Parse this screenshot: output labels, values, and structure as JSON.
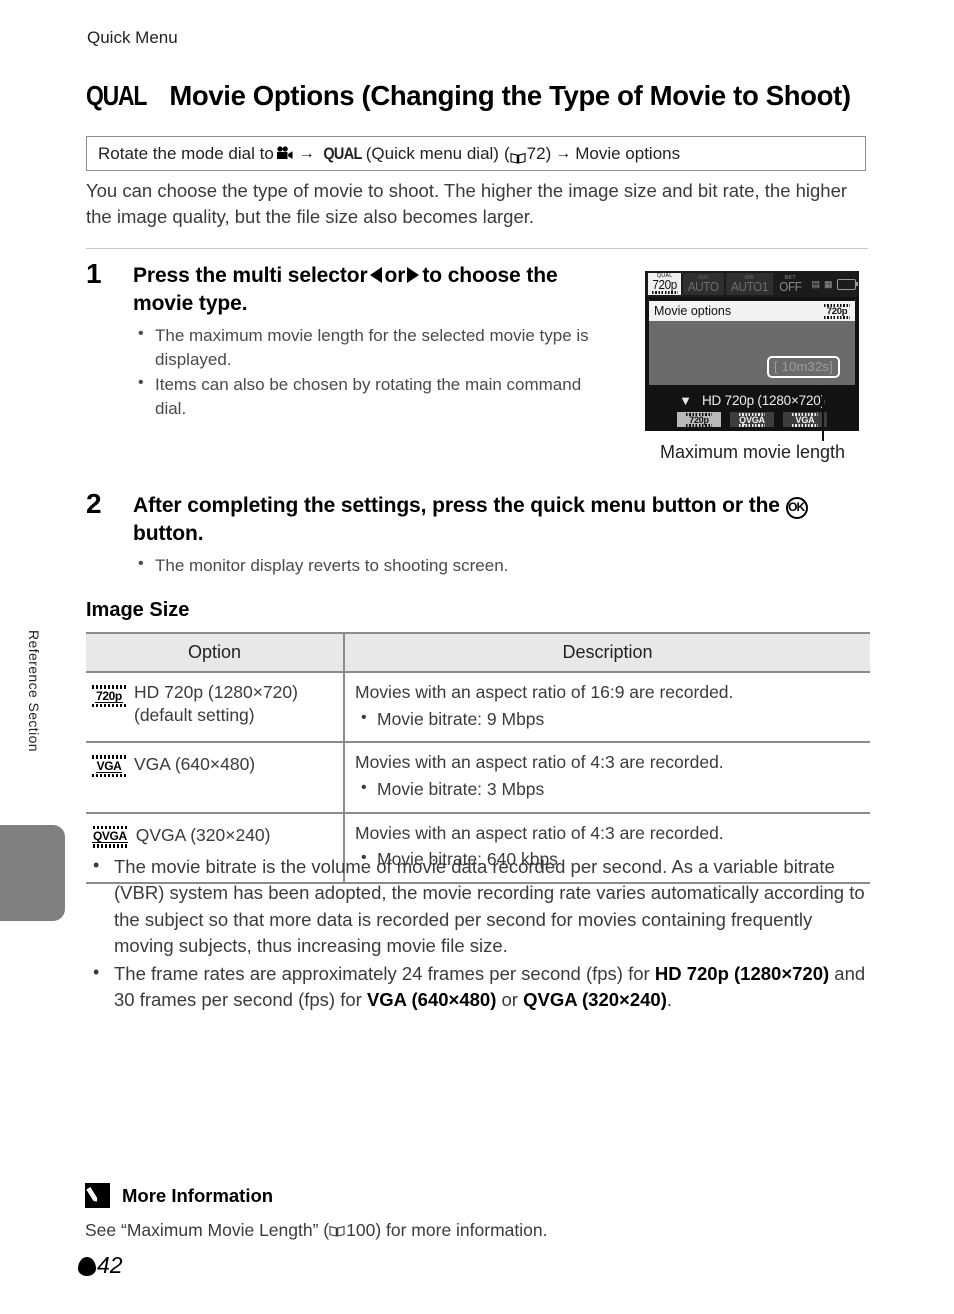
{
  "running_head": "Quick Menu",
  "side_tab_label": "Reference Section",
  "title": {
    "icon_label": "QUAL",
    "text": "Movie Options (Changing the Type of Movie to Shoot)"
  },
  "path_box": {
    "part1": "Rotate the mode dial to",
    "movie_icon": "movie-mode-icon",
    "arrow1": "→",
    "qual_icon": "QUAL",
    "part2": "(Quick menu dial)",
    "open_paren": "(",
    "book_ref": "72",
    "close_paren": ")",
    "arrow2": "→",
    "part3": "Movie options"
  },
  "intro": "You can choose the type of movie to shoot. The higher the image size and bit rate, the higher the image quality, but the file size also becomes larger.",
  "steps": [
    {
      "number": "1",
      "head_before": "Press the multi selector",
      "head_or": "or",
      "head_after": "to choose the movie type.",
      "bullets": [
        "The maximum movie length for the selected movie type is displayed.",
        "Items can also be chosen by rotating the main command dial."
      ]
    },
    {
      "number": "2",
      "head_before": "After completing the settings, press the quick menu button or the",
      "ok_glyph": "OK",
      "head_after": "button.",
      "bullets": [
        "The monitor display reverts to shooting screen."
      ]
    }
  ],
  "camera_screen": {
    "topbar": [
      {
        "sup": "QUAL",
        "main": "720p",
        "state": "active"
      },
      {
        "sup": "ISO",
        "main": "AUTO",
        "state": "dim"
      },
      {
        "sup": "WB",
        "main": "AUTO1",
        "state": "dim"
      },
      {
        "sup": "BKT",
        "main": "OFF",
        "state": "plain"
      }
    ],
    "topbar_icons": [
      "mg-icon",
      "sd-card-icon",
      "battery-icon"
    ],
    "menu_row_label": "Movie options",
    "menu_row_badge": "720p",
    "max_length_value": "[ 10m32s]",
    "bottom_label": "HD 720p (1280×720)",
    "chips": [
      {
        "label": "720p",
        "selected": true
      },
      {
        "label": "QVGA",
        "selected": false
      },
      {
        "label": "VGA",
        "selected": false
      }
    ],
    "caption": "Maximum movie length"
  },
  "section_heading": "Image Size",
  "table": {
    "headers": [
      "Option",
      "Description"
    ],
    "rows": [
      {
        "badge": "720p",
        "option": "HD 720p (1280×720)",
        "option_note": "(default setting)",
        "desc_main": "Movies with an aspect ratio of 16:9 are recorded.",
        "desc_bullet": "Movie bitrate: 9 Mbps"
      },
      {
        "badge": "VGA",
        "option": "VGA (640×480)",
        "option_note": "",
        "desc_main": "Movies with an aspect ratio of 4:3 are recorded.",
        "desc_bullet": "Movie bitrate: 3 Mbps"
      },
      {
        "badge": "QVGA",
        "option": "QVGA (320×240)",
        "option_note": "",
        "desc_main": "Movies with an aspect ratio of 4:3 are recorded.",
        "desc_bullet": "Movie bitrate: 640 kbps"
      }
    ]
  },
  "notes": {
    "note1": "The movie bitrate is the volume of movie data recorded per second. As a variable bitrate (VBR) system has been adopted, the movie recording rate varies automatically according to the subject so that more data is recorded per second for movies containing frequently moving subjects, thus increasing movie file size.",
    "note2": {
      "p1": "The frame rates are approximately 24 frames per second (fps) for ",
      "b1": "HD 720p (1280×720)",
      "p2": " and 30 frames per second (fps) for ",
      "b2": "VGA (640×480)",
      "p3": " or ",
      "b3": "QVGA (320×240)",
      "p4": "."
    }
  },
  "more_information": {
    "title": "More Information",
    "text_before": "See “Maximum Movie Length” (",
    "book_ref": "100",
    "text_after": ") for more information."
  },
  "folio": {
    "page_number": "42"
  }
}
